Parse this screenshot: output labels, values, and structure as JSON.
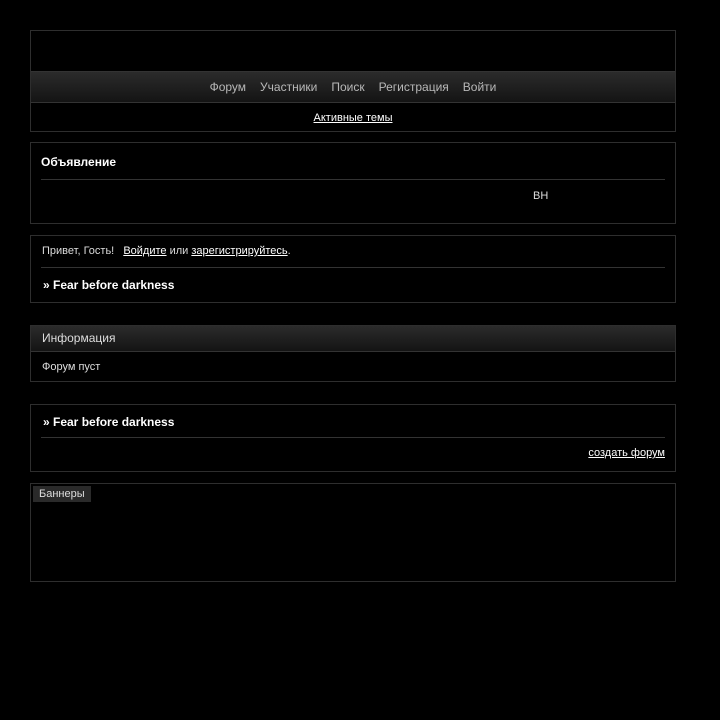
{
  "nav": {
    "items": [
      "Форум",
      "Участники",
      "Поиск",
      "Регистрация",
      "Войти"
    ],
    "active_topics": "Активные темы"
  },
  "announcement": {
    "title": "Объявление",
    "marquee_text": "вн"
  },
  "welcome": {
    "greeting": "Привет, Гость!",
    "login_link": "Войдите",
    "or_text": "или",
    "register_link": "зарегистрируйтесь",
    "period": ".",
    "crumb": "» Fear before darkness"
  },
  "info": {
    "title": "Информация",
    "body": "Форум пуст"
  },
  "footer": {
    "crumb": "» Fear before darkness",
    "create_forum": "создать форум"
  },
  "banners": {
    "tab_label": "Баннеры"
  },
  "colors": {
    "background": "#000000",
    "border": "#2e2e2e",
    "nav_text": "#b8b8b8"
  }
}
